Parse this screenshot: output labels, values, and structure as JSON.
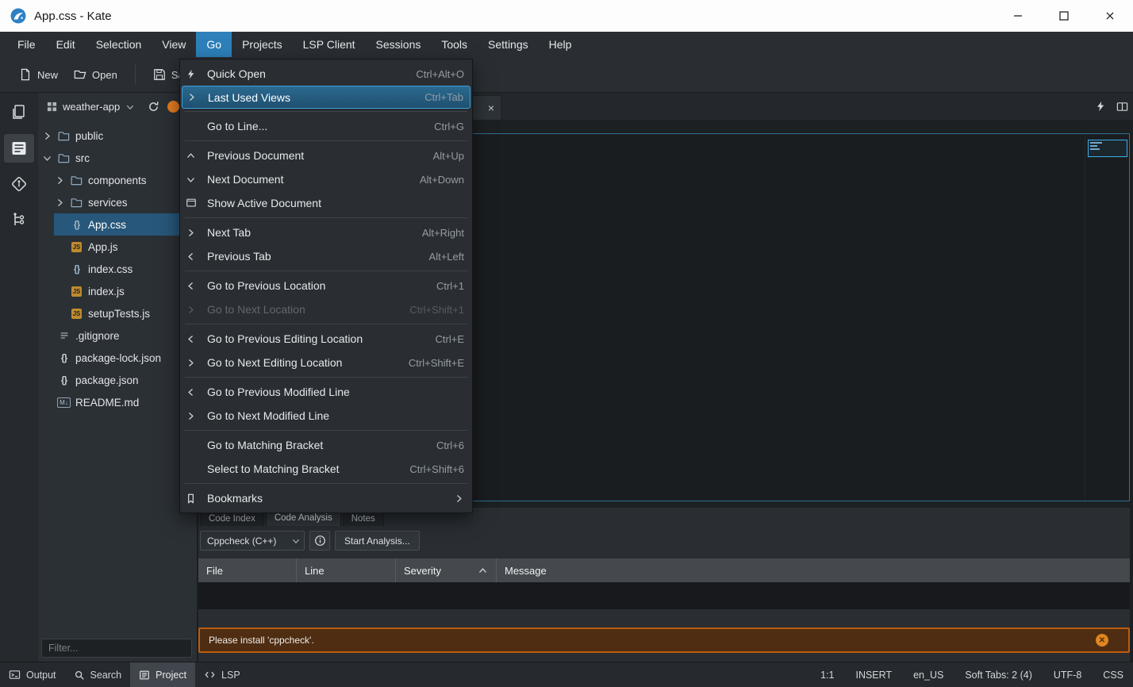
{
  "window": {
    "title": "App.css - Kate"
  },
  "menubar": {
    "items": [
      {
        "label": "File"
      },
      {
        "label": "Edit"
      },
      {
        "label": "Selection"
      },
      {
        "label": "View"
      },
      {
        "label": "Go",
        "active": true
      },
      {
        "label": "Projects"
      },
      {
        "label": "LSP Client"
      },
      {
        "label": "Sessions"
      },
      {
        "label": "Tools"
      },
      {
        "label": "Settings"
      },
      {
        "label": "Help"
      }
    ]
  },
  "toolbar": {
    "new_label": "New",
    "open_label": "Open",
    "save_label": "Save"
  },
  "go_menu": {
    "items": [
      {
        "label": "Quick Open",
        "shortcut": "Ctrl+Alt+O",
        "icon": "lightning"
      },
      {
        "label": "Last Used Views",
        "shortcut": "Ctrl+Tab",
        "icon": "chevron-right",
        "highlighted": true
      },
      {
        "type": "separator"
      },
      {
        "label": "Go to Line...",
        "shortcut": "Ctrl+G"
      },
      {
        "type": "separator"
      },
      {
        "label": "Previous Document",
        "shortcut": "Alt+Up",
        "icon": "chevron-up"
      },
      {
        "label": "Next Document",
        "shortcut": "Alt+Down",
        "icon": "chevron-down"
      },
      {
        "label": "Show Active Document",
        "icon": "document"
      },
      {
        "type": "separator"
      },
      {
        "label": "Next Tab",
        "shortcut": "Alt+Right",
        "icon": "chevron-right"
      },
      {
        "label": "Previous Tab",
        "shortcut": "Alt+Left",
        "icon": "chevron-left"
      },
      {
        "type": "separator"
      },
      {
        "label": "Go to Previous Location",
        "shortcut": "Ctrl+1",
        "icon": "chevron-left"
      },
      {
        "label": "Go to Next Location",
        "shortcut": "Ctrl+Shift+1",
        "icon": "chevron-right",
        "disabled": true
      },
      {
        "type": "separator"
      },
      {
        "label": "Go to Previous Editing Location",
        "shortcut": "Ctrl+E",
        "icon": "chevron-left"
      },
      {
        "label": "Go to Next Editing Location",
        "shortcut": "Ctrl+Shift+E",
        "icon": "chevron-right"
      },
      {
        "type": "separator"
      },
      {
        "label": "Go to Previous Modified Line",
        "icon": "chevron-left"
      },
      {
        "label": "Go to Next Modified Line",
        "icon": "chevron-right"
      },
      {
        "type": "separator"
      },
      {
        "label": "Go to Matching Bracket",
        "shortcut": "Ctrl+6"
      },
      {
        "label": "Select to Matching Bracket",
        "shortcut": "Ctrl+Shift+6"
      },
      {
        "type": "separator"
      },
      {
        "label": "Bookmarks",
        "icon": "bookmark",
        "submenu": true
      }
    ]
  },
  "project": {
    "name": "weather-app",
    "filter_placeholder": "Filter...",
    "tree": [
      {
        "name": "public",
        "icon": "folder",
        "depth": 0,
        "chevron": "collapsed"
      },
      {
        "name": "src",
        "icon": "folder",
        "depth": 0,
        "chevron": "expanded"
      },
      {
        "name": "components",
        "icon": "folder",
        "depth": 1,
        "chevron": "collapsed"
      },
      {
        "name": "services",
        "icon": "folder",
        "depth": 1,
        "chevron": "collapsed"
      },
      {
        "name": "App.css",
        "icon": "css",
        "depth": 1,
        "selected": true
      },
      {
        "name": "App.js",
        "icon": "js",
        "depth": 1
      },
      {
        "name": "index.css",
        "icon": "css",
        "depth": 1
      },
      {
        "name": "index.js",
        "icon": "js",
        "depth": 1
      },
      {
        "name": "setupTests.js",
        "icon": "js",
        "depth": 1
      },
      {
        "name": ".gitignore",
        "icon": "text",
        "depth": 0
      },
      {
        "name": "package-lock.json",
        "icon": "json",
        "depth": 0
      },
      {
        "name": "package.json",
        "icon": "json",
        "depth": 0
      },
      {
        "name": "README.md",
        "icon": "markdown",
        "depth": 0
      }
    ]
  },
  "bottom_panel": {
    "tabs": [
      {
        "label": "Code Index"
      },
      {
        "label": "Code Analysis",
        "active": true
      },
      {
        "label": "Notes"
      }
    ],
    "analysis": {
      "tool": "Cppcheck (C++)",
      "start_label": "Start Analysis...",
      "columns": [
        "File",
        "Line",
        "Severity",
        "Message"
      ],
      "sorted_column": "Severity",
      "warning": "Please install 'cppcheck'."
    }
  },
  "statusbar": {
    "left": [
      {
        "label": "Output",
        "icon": "console"
      },
      {
        "label": "Search",
        "icon": "search"
      },
      {
        "label": "Project",
        "icon": "project",
        "active": true
      },
      {
        "label": "LSP",
        "icon": "code"
      }
    ],
    "right": [
      "1:1",
      "INSERT",
      "en_US",
      "Soft Tabs: 2 (4)",
      "UTF-8",
      "CSS"
    ]
  }
}
